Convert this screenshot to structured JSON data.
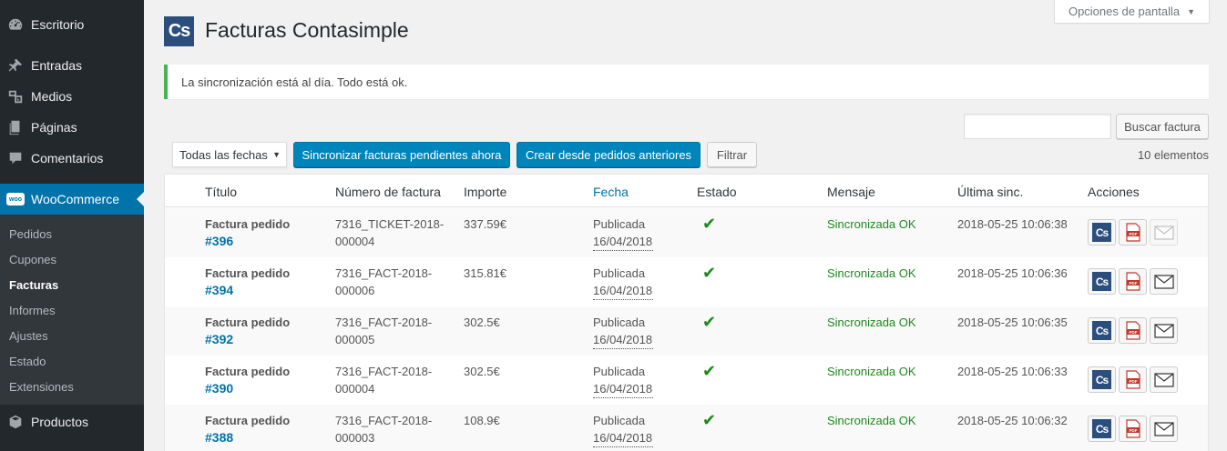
{
  "sidebar": {
    "items": [
      {
        "label": "Escritorio",
        "icon": "dashboard-icon"
      },
      {
        "label": "Entradas",
        "icon": "pin-icon"
      },
      {
        "label": "Medios",
        "icon": "media-icon"
      },
      {
        "label": "Páginas",
        "icon": "pages-icon"
      },
      {
        "label": "Comentarios",
        "icon": "comments-icon"
      },
      {
        "label": "WooCommerce",
        "icon": "woo-icon"
      },
      {
        "label": "Productos",
        "icon": "box-icon"
      }
    ],
    "submenu": [
      "Pedidos",
      "Cupones",
      "Facturas",
      "Informes",
      "Ajustes",
      "Estado",
      "Extensiones"
    ],
    "woo_badge": "woo"
  },
  "header": {
    "logo_text": "Cs",
    "title": "Facturas Contasimple",
    "screen_options": "Opciones de pantalla"
  },
  "notice": "La sincronización está al día. Todo está ok.",
  "search": {
    "button": "Buscar factura",
    "value": ""
  },
  "tablenav": {
    "date_filter": "Todas las fechas",
    "sync_button": "Sincronizar facturas pendientes ahora",
    "create_button": "Crear desde pedidos anteriores",
    "filter_button": "Filtrar",
    "count": "10 elementos"
  },
  "table": {
    "headers": [
      "Título",
      "Número de factura",
      "Importe",
      "Fecha",
      "Estado",
      "Mensaje",
      "Última sinc.",
      "Acciones"
    ],
    "rows": [
      {
        "title": "Factura pedido",
        "order": "#396",
        "number": "7316_TICKET-2018-000004",
        "amount": "337.59€",
        "status": "Publicada",
        "date": "16/04/2018",
        "state": "✔",
        "message": "Sincronizada OK",
        "last_sync": "2018-05-25 10:06:38"
      },
      {
        "title": "Factura pedido",
        "order": "#394",
        "number": "7316_FACT-2018-000006",
        "amount": "315.81€",
        "status": "Publicada",
        "date": "16/04/2018",
        "state": "✔",
        "message": "Sincronizada OK",
        "last_sync": "2018-05-25 10:06:36"
      },
      {
        "title": "Factura pedido",
        "order": "#392",
        "number": "7316_FACT-2018-000005",
        "amount": "302.5€",
        "status": "Publicada",
        "date": "16/04/2018",
        "state": "✔",
        "message": "Sincronizada OK",
        "last_sync": "2018-05-25 10:06:35"
      },
      {
        "title": "Factura pedido",
        "order": "#390",
        "number": "7316_FACT-2018-000004",
        "amount": "302.5€",
        "status": "Publicada",
        "date": "16/04/2018",
        "state": "✔",
        "message": "Sincronizada OK",
        "last_sync": "2018-05-25 10:06:33"
      },
      {
        "title": "Factura pedido",
        "order": "#388",
        "number": "7316_FACT-2018-000003",
        "amount": "108.9€",
        "status": "Publicada",
        "date": "16/04/2018",
        "state": "✔",
        "message": "Sincronizada OK",
        "last_sync": "2018-05-25 10:06:32"
      }
    ],
    "action_cs": "Cs",
    "action_pdf": "PDF"
  }
}
